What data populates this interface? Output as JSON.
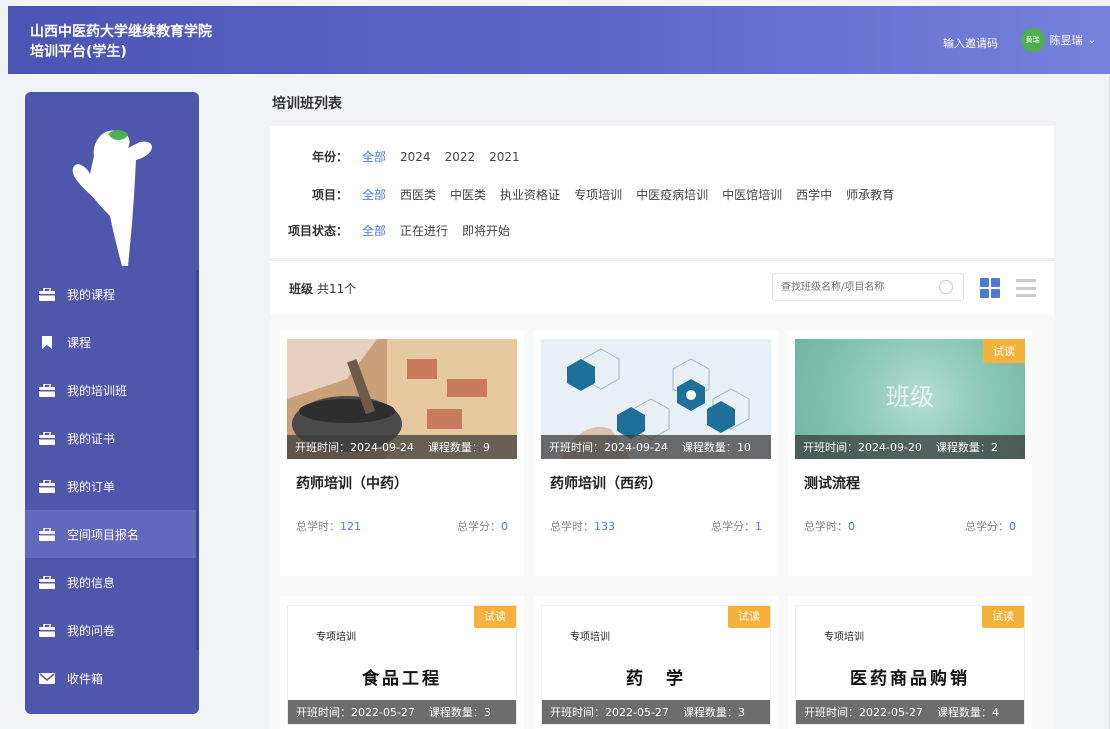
{
  "header": {
    "brand_line1": "山西中医药大学继续教育学院",
    "brand_line2": "培训平台(学生)",
    "invite_code": "输入邀请码",
    "avatar_text": "黄瑞",
    "user_name": "陈昱瑞",
    "accent": "#4a55b4"
  },
  "sidebar": {
    "items": [
      {
        "label": "我的课程",
        "icon": "briefcase-icon"
      },
      {
        "label": "课程",
        "icon": "bookmark-icon"
      },
      {
        "label": "我的培训班",
        "icon": "briefcase-icon"
      },
      {
        "label": "我的证书",
        "icon": "briefcase-icon"
      },
      {
        "label": "我的订单",
        "icon": "briefcase-icon"
      },
      {
        "label": "空间项目报名",
        "icon": "briefcase-icon"
      },
      {
        "label": "我的信息",
        "icon": "briefcase-icon"
      },
      {
        "label": "我的问卷",
        "icon": "briefcase-icon"
      },
      {
        "label": "收件箱",
        "icon": "mail-icon"
      }
    ]
  },
  "main": {
    "page_title": "培训班列表",
    "filters": {
      "year_label": "年份：",
      "year_options": [
        "全部",
        "2024",
        "2022",
        "2021"
      ],
      "project_label": "项目：",
      "project_options": [
        "全部",
        "西医类",
        "中医类",
        "执业资格证",
        "专项培训",
        "中医疫病培训",
        "中医馆培训",
        "西学中",
        "师承教育"
      ],
      "status_label": "项目状态：",
      "status_options": [
        "全部",
        "正在进行",
        "即将开始"
      ]
    },
    "list": {
      "title": "班级",
      "count": "共11个",
      "search_placeholder": "查找班级名称/项目名称"
    },
    "cards": [
      {
        "title": "药师培训（中药）",
        "start_label": "开班时间：",
        "start": "2024-09-24",
        "course_label": "课程数量：",
        "courses": "9",
        "hours_label": "总学时：",
        "hours": "121",
        "credits_label": "总学分：",
        "credits": "0",
        "tag": ""
      },
      {
        "title": "药师培训（西药）",
        "start_label": "开班时间：",
        "start": "2024-09-24",
        "course_label": "课程数量：",
        "courses": "10",
        "hours_label": "总学时：",
        "hours": "133",
        "credits_label": "总学分：",
        "credits": "1",
        "tag": ""
      },
      {
        "title": "测试流程",
        "start_label": "开班时间：",
        "start": "2024-09-20",
        "course_label": "课程数量：",
        "courses": "2",
        "hours_label": "总学时：",
        "hours": "0",
        "credits_label": "总学分：",
        "credits": "0",
        "tag": "试读",
        "thumb_text": "班级"
      },
      {
        "doc_small": "专项培训",
        "doc_big": "食品工程",
        "start_label": "开班时间：",
        "start": "2022-05-27",
        "course_label": "课程数量：",
        "courses": "3",
        "tag": "试读"
      },
      {
        "doc_small": "专项培训",
        "doc_big": "药　学",
        "start_label": "开班时间：",
        "start": "2022-05-27",
        "course_label": "课程数量：",
        "courses": "3",
        "tag": "试读"
      },
      {
        "doc_small": "专项培训",
        "doc_big": "医药商品购销",
        "start_label": "开班时间：",
        "start": "2022-05-27",
        "course_label": "课程数量：",
        "courses": "4",
        "tag": "试读"
      }
    ]
  }
}
